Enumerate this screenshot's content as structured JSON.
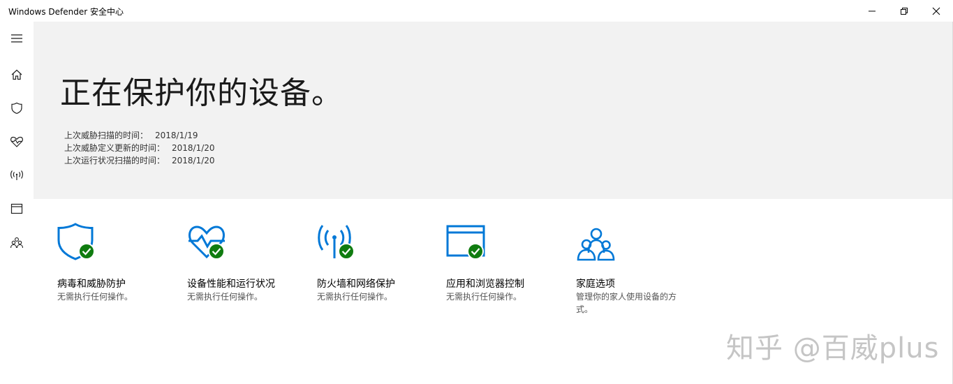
{
  "window": {
    "title": "Windows Defender 安全中心"
  },
  "sidebar": {
    "items": [
      {
        "icon": "hamburger-menu-icon"
      },
      {
        "icon": "home-icon"
      },
      {
        "icon": "shield-icon"
      },
      {
        "icon": "heart-pulse-icon"
      },
      {
        "icon": "network-antenna-icon"
      },
      {
        "icon": "browser-window-icon"
      },
      {
        "icon": "family-icon"
      }
    ]
  },
  "hero": {
    "title": "正在保护你的设备。",
    "scans": [
      {
        "label": "上次威胁扫描的时间：",
        "value": "2018/1/19"
      },
      {
        "label": "上次威胁定义更新的时间：",
        "value": "2018/1/20"
      },
      {
        "label": "上次运行状况扫描的时间：",
        "value": "2018/1/20"
      }
    ]
  },
  "tiles": [
    {
      "title": "病毒和威胁防护",
      "desc": "无需执行任何操作。",
      "icon": "shield-icon"
    },
    {
      "title": "设备性能和运行状况",
      "desc": "无需执行任何操作。",
      "icon": "heart-pulse-icon"
    },
    {
      "title": "防火墙和网络保护",
      "desc": "无需执行任何操作。",
      "icon": "network-antenna-icon"
    },
    {
      "title": "应用和浏览器控制",
      "desc": "无需执行任何操作。",
      "icon": "browser-window-icon"
    },
    {
      "title": "家庭选项",
      "desc": "管理你的家人使用设备的方式。",
      "icon": "family-icon"
    }
  ],
  "watermark": "知乎 @百威plus",
  "colors": {
    "accent": "#0078d7",
    "ok": "#107c10",
    "hero_bg": "#f2f2f2"
  }
}
